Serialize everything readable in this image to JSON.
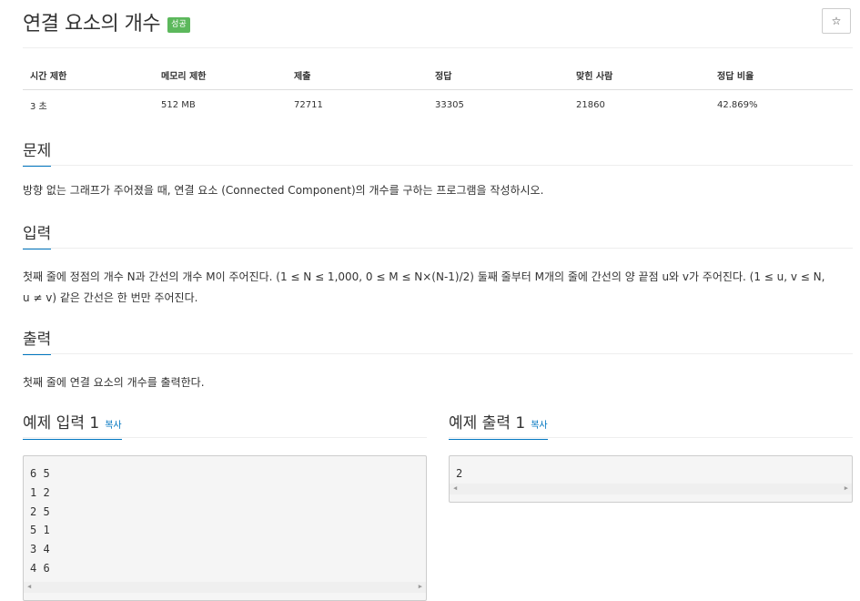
{
  "header": {
    "title": "연결 요소의 개수",
    "badge": "성공",
    "star_icon": "☆"
  },
  "stats": {
    "headers": [
      "시간 제한",
      "메모리 제한",
      "제출",
      "정답",
      "맞힌 사람",
      "정답 비율"
    ],
    "values": [
      "3 초",
      "512 MB",
      "72711",
      "33305",
      "21860",
      "42.869%"
    ]
  },
  "sections": {
    "problem": {
      "title": "문제",
      "body": "방향 없는 그래프가 주어졌을 때, 연결 요소 (Connected Component)의 개수를 구하는 프로그램을 작성하시오."
    },
    "input": {
      "title": "입력",
      "body": "첫째 줄에 정점의 개수 N과 간선의 개수 M이 주어진다. (1 ≤ N ≤ 1,000, 0 ≤ M ≤ N×(N-1)/2) 둘째 줄부터 M개의 줄에 간선의 양 끝점 u와 v가 주어진다. (1 ≤ u, v ≤ N, u ≠ v) 같은 간선은 한 번만 주어진다."
    },
    "output": {
      "title": "출력",
      "body": "첫째 줄에 연결 요소의 개수를 출력한다."
    }
  },
  "samples": {
    "input": {
      "title": "예제 입력 1",
      "copy": "복사",
      "lines": [
        "6 5",
        "1 2",
        "2 5",
        "5 1",
        "3 4",
        "4 6"
      ]
    },
    "output": {
      "title": "예제 출력 1",
      "copy": "복사",
      "lines": [
        "2"
      ]
    }
  },
  "colors": {
    "badge_green": "#5cb85c",
    "link_blue": "#0076c0"
  }
}
